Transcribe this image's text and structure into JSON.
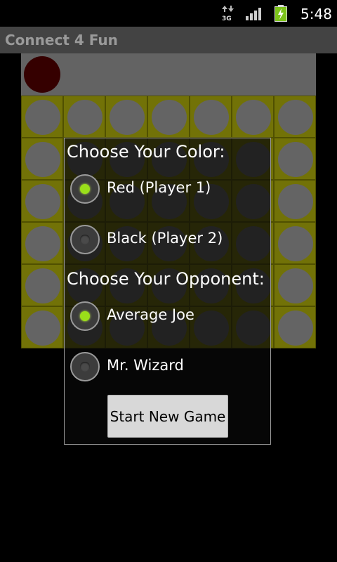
{
  "status_bar": {
    "time": "5:48",
    "network_label": "3G",
    "icons": [
      "data-transfer-icon",
      "signal-icon",
      "battery-charging-icon"
    ]
  },
  "app": {
    "title": "Connect 4 Fun"
  },
  "board": {
    "columns": 7,
    "rows": 6,
    "board_color": "#e5e50f",
    "empty_slot_color": "#c8c8c8",
    "preview_piece_color": "#6a0000"
  },
  "dialog": {
    "color_heading": "Choose Your Color:",
    "color_options": [
      {
        "label": "Red (Player 1)",
        "selected": true
      },
      {
        "label": "Black (Player 2)",
        "selected": false
      }
    ],
    "opponent_heading": "Choose Your Opponent:",
    "opponent_options": [
      {
        "label": "Average Joe",
        "selected": true
      },
      {
        "label": "Mr. Wizard",
        "selected": false
      }
    ],
    "start_button_label": "Start New Game",
    "selected_radio_color": "#9adf1a"
  }
}
